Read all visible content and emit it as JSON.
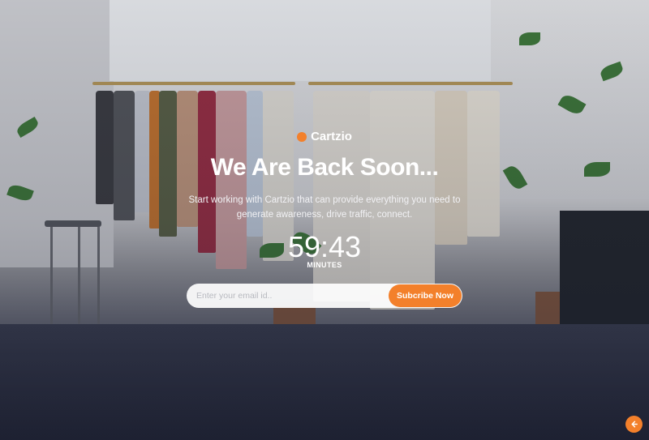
{
  "brand": {
    "name": "Cartzio",
    "accent_color": "#f3802b"
  },
  "hero": {
    "headline": "We Are Back Soon...",
    "description": "Start working with Cartzio that can provide everything you need to generate awareness, drive traffic, connect."
  },
  "countdown": {
    "value": "59:43",
    "unit_label": "MINUTES"
  },
  "subscribe": {
    "email_placeholder": "Enter your email id..",
    "email_value": "",
    "button_label": "Subcribe Now"
  },
  "icons": {
    "brand_logo": "orange-dot-icon",
    "back_to_top": "arrow-left-icon"
  }
}
